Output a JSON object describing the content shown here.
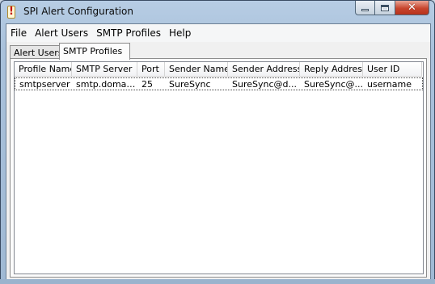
{
  "window": {
    "title": "SPI Alert Configuration",
    "app_icon_glyph": "!",
    "icon_name": "alert-exclamation-icon"
  },
  "menu": {
    "items": [
      {
        "label": "File"
      },
      {
        "label": "Alert Users"
      },
      {
        "label": "SMTP Profiles"
      },
      {
        "label": "Help"
      }
    ]
  },
  "tabs": {
    "items": [
      {
        "label": "Alert Users",
        "selected": false
      },
      {
        "label": "SMTP Profiles",
        "selected": true
      }
    ]
  },
  "table": {
    "columns": [
      "Profile Name",
      "SMTP Server",
      "Port",
      "Sender Name",
      "Sender Address",
      "Reply Address",
      "User ID"
    ],
    "rows": [
      {
        "profile_name": "smtpserver",
        "smtp_server": "smtp.domain...",
        "port": "25",
        "sender_name": "SureSync",
        "sender_address": "SureSync@d...",
        "reply_address": "SureSync@...",
        "user_id": "username"
      }
    ]
  },
  "colors": {
    "title_bar": "#a9c1db",
    "close_button": "#c7452d",
    "app_icon_mark": "#c41010"
  }
}
